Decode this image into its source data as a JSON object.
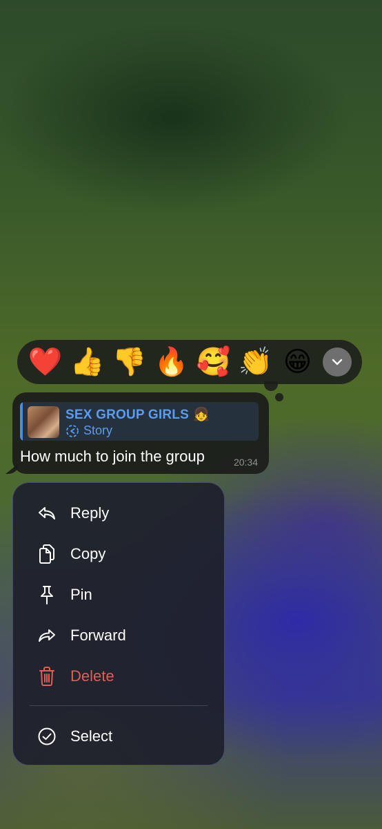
{
  "reactions": {
    "emojis": [
      "❤️",
      "👍",
      "👎",
      "🔥",
      "🥰",
      "👏",
      "😁"
    ],
    "more_icon": "chevron-down-icon"
  },
  "message": {
    "quote_title": "SEX GROUP GIRLS",
    "quote_title_emoji": "👧",
    "quote_subtitle": "Story",
    "text": "How much to join the group",
    "time": "20:34"
  },
  "menu": {
    "items": [
      {
        "label": "Reply",
        "icon": "reply-icon"
      },
      {
        "label": "Copy",
        "icon": "copy-icon"
      },
      {
        "label": "Pin",
        "icon": "pin-icon"
      },
      {
        "label": "Forward",
        "icon": "forward-icon"
      },
      {
        "label": "Delete",
        "icon": "trash-icon"
      },
      {
        "label": "Select",
        "icon": "check-circle-icon"
      }
    ]
  },
  "colors": {
    "accent_blue": "#5c9cf0",
    "danger_red": "#e35d57",
    "menu_bg": "#1e202c",
    "bubble_bg": "#1a1c1a"
  }
}
